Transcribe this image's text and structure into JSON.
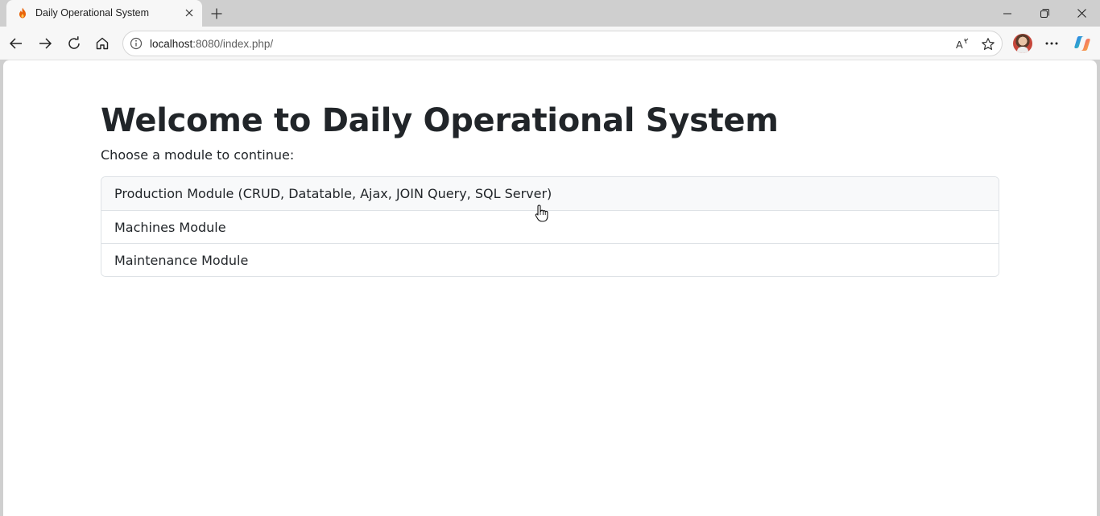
{
  "browser": {
    "tab_title": "Daily Operational System",
    "url_host": "localhost",
    "url_rest": ":8080/index.php/",
    "accent_color": "#e8630a"
  },
  "icons": {
    "favicon": "flame-icon",
    "tab_close": "close-icon",
    "new_tab": "plus-icon",
    "back": "arrow-left-icon",
    "forward": "arrow-right-icon",
    "reload": "reload-icon",
    "home": "home-icon",
    "site_info": "info-icon",
    "read_aloud": "read-aloud-icon",
    "favorite": "star-icon",
    "menu": "more-horizontal-icon",
    "copilot": "copilot-icon"
  },
  "page": {
    "heading": "Welcome to Daily Operational System",
    "subtext": "Choose a module to continue:",
    "modules": [
      {
        "label": "Production Module (CRUD, Datatable, Ajax, JOIN Query, SQL Server)"
      },
      {
        "label": "Machines Module"
      },
      {
        "label": "Maintenance Module"
      }
    ]
  }
}
